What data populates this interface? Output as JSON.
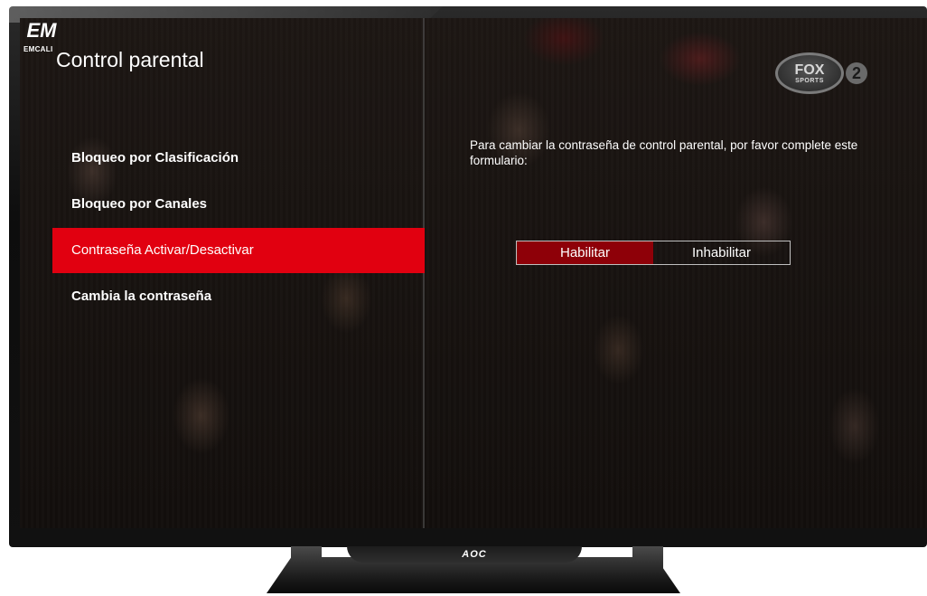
{
  "brand": {
    "logo_mark": "EM",
    "logo_text": "EMCALI"
  },
  "header": {
    "title": "Control parental"
  },
  "menu": {
    "items": [
      {
        "label": "Bloqueo por Clasificación"
      },
      {
        "label": "Bloqueo por Canales"
      },
      {
        "label": "Contraseña Activar/Desactivar"
      },
      {
        "label": "Cambia la contraseña"
      }
    ],
    "selected_index": 2
  },
  "channel": {
    "name": "FOX",
    "subtitle": "SPORTS",
    "number": "2"
  },
  "form": {
    "instructions": "Para cambiar la contraseña de control parental, por favor complete este formulario:",
    "options": [
      {
        "label": "Habilitar"
      },
      {
        "label": "Inhabilitar"
      }
    ],
    "selected_option": "Habilitar"
  },
  "tv": {
    "brand": "AOC"
  },
  "colors": {
    "menu_highlight": "#e10010",
    "toggle_selected": "#8e0008",
    "text": "#ffffff"
  }
}
